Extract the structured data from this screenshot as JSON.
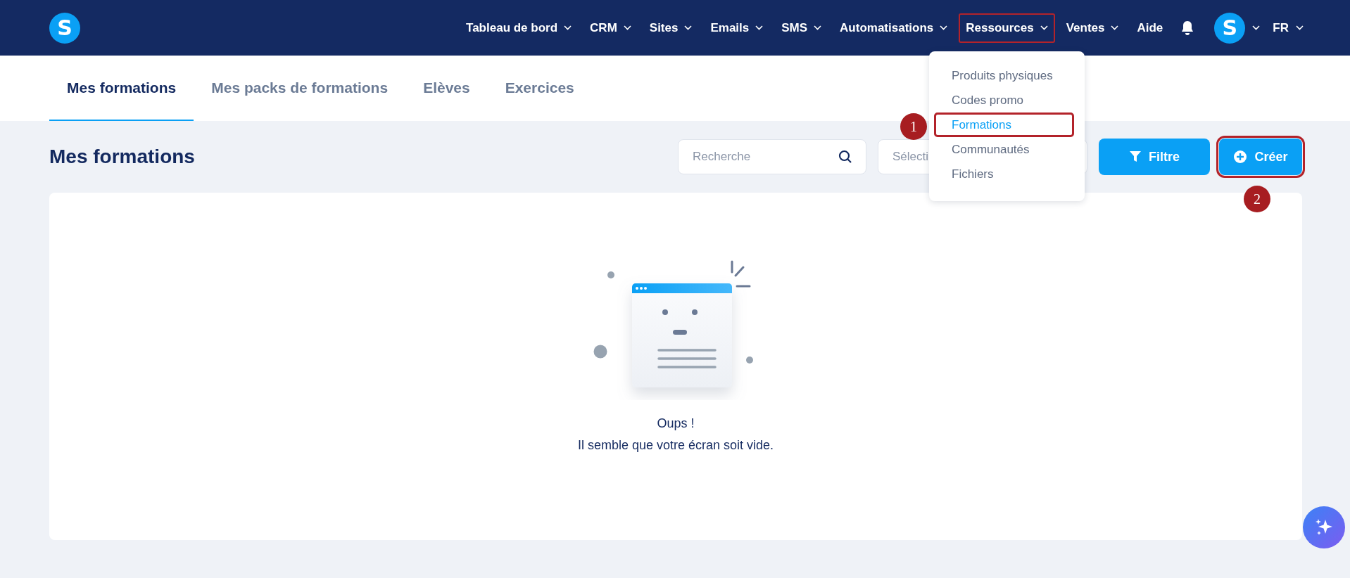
{
  "header": {
    "logo": "S",
    "nav": [
      {
        "label": "Tableau de bord",
        "caret": true,
        "highlighted": false
      },
      {
        "label": "CRM",
        "caret": true,
        "highlighted": false
      },
      {
        "label": "Sites",
        "caret": true,
        "highlighted": false
      },
      {
        "label": "Emails",
        "caret": true,
        "highlighted": false
      },
      {
        "label": "SMS",
        "caret": true,
        "highlighted": false
      },
      {
        "label": "Automatisations",
        "caret": true,
        "highlighted": false
      },
      {
        "label": "Ressources",
        "caret": true,
        "highlighted": true
      },
      {
        "label": "Ventes",
        "caret": true,
        "highlighted": false
      },
      {
        "label": "Aide",
        "caret": false,
        "highlighted": false
      }
    ],
    "avatar": "S",
    "language": "FR"
  },
  "dropdown": {
    "items": [
      {
        "label": "Produits physiques",
        "selected": false,
        "highlighted": false
      },
      {
        "label": "Codes promo",
        "selected": false,
        "highlighted": false
      },
      {
        "label": "Formations",
        "selected": true,
        "highlighted": true
      },
      {
        "label": "Communautés",
        "selected": false,
        "highlighted": false
      },
      {
        "label": "Fichiers",
        "selected": false,
        "highlighted": false
      }
    ]
  },
  "tabs": [
    {
      "label": "Mes formations",
      "selected": true
    },
    {
      "label": "Mes packs de formations",
      "selected": false
    },
    {
      "label": "Elèves",
      "selected": false
    },
    {
      "label": "Exercices",
      "selected": false
    }
  ],
  "page_title": "Mes formations",
  "search": {
    "placeholder": "Recherche"
  },
  "select": {
    "placeholder": "Sélecti"
  },
  "filter_button": "Filtre",
  "create_button": {
    "label": "Créer",
    "highlighted": true
  },
  "annotations": [
    {
      "label": "1"
    },
    {
      "label": "2"
    }
  ],
  "empty_state": {
    "title": "Oups !",
    "message": "Il semble que votre écran soit vide."
  }
}
